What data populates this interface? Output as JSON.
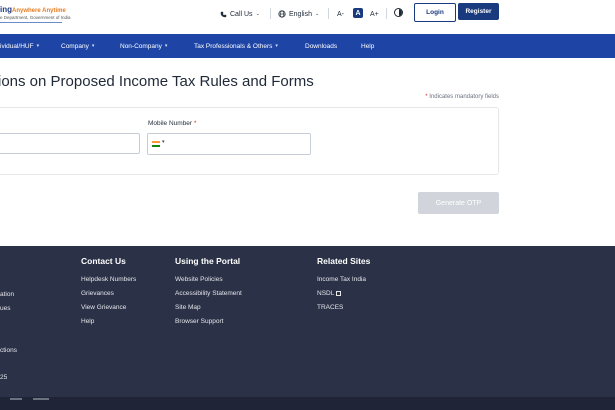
{
  "header": {
    "logo_line1_prefix": "ing",
    "logo_line1_hi": "Anywhere Anytime",
    "logo_line2": "e Department, Government of India",
    "call_us": "Call Us",
    "language": "English",
    "font_small": "A-",
    "font_normal": "A",
    "font_large": "A+",
    "login": "Login",
    "register": "Register"
  },
  "nav": [
    {
      "label": "ividual/HUF"
    },
    {
      "label": "Company"
    },
    {
      "label": "Non-Company"
    },
    {
      "label": "Tax Professionals & Others"
    },
    {
      "label": "Downloads"
    },
    {
      "label": "Help"
    }
  ],
  "main": {
    "title": "ions on Proposed Income Tax Rules and Forms",
    "mandatory_star": "*",
    "mandatory_text": "Indicates mandatory fields",
    "mobile_label": "Mobile Number",
    "required_star": "*",
    "otp_button": "Generate OTP"
  },
  "footer": {
    "col0": [
      "ation",
      "ues",
      "ctions",
      "25"
    ],
    "contact_head": "Contact Us",
    "contact_links": [
      "Helpdesk Numbers",
      "Grievances",
      "View Grievance",
      "Help"
    ],
    "portal_head": "Using the Portal",
    "portal_links": [
      "Website Policies",
      "Accessibility Statement",
      "Site Map",
      "Browser Support"
    ],
    "related_head": "Related Sites",
    "related_links": [
      "Income Tax India",
      "NSDL",
      "TRACES"
    ]
  },
  "colors": {
    "brand_blue": "#1a3a80",
    "nav_blue": "#1e45a6",
    "footer_bg": "#2b3147",
    "required_red": "#d32f2f"
  },
  "icons": {
    "call": "phone-icon",
    "language": "globe-icon",
    "contrast": "contrast-icon",
    "external": "external-link-icon",
    "flag": "india-flag-icon"
  }
}
